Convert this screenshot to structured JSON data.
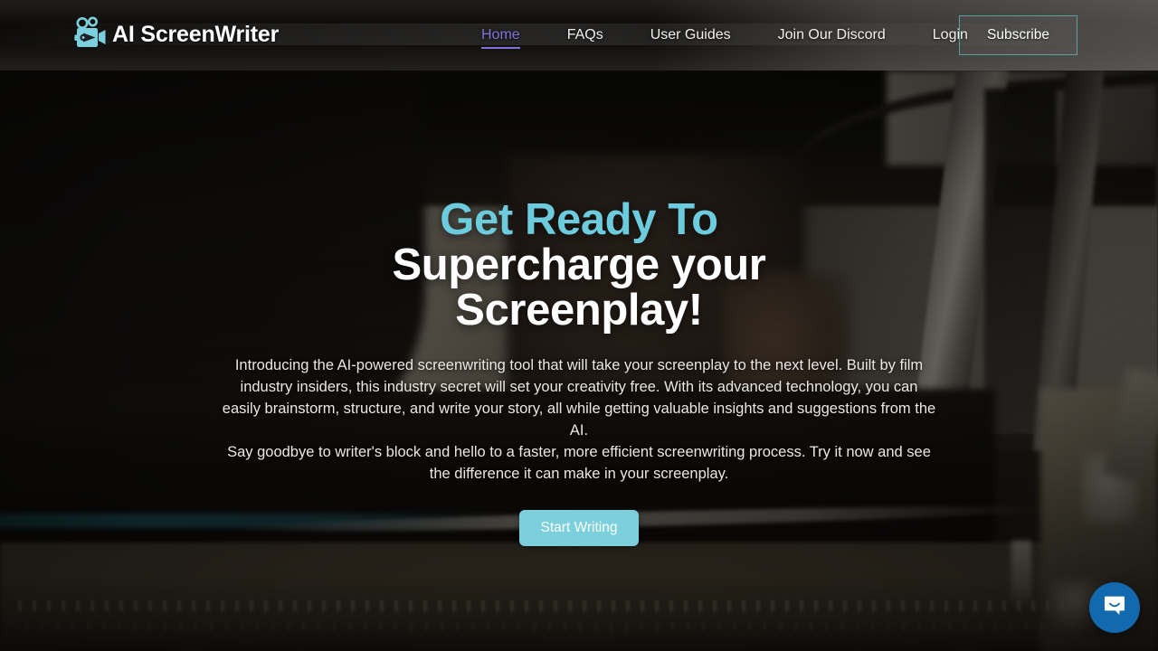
{
  "brand": {
    "name": "AI ScreenWriter",
    "icon": "movie-camera-icon",
    "color": "#7ccfdd"
  },
  "header": {
    "nav": [
      {
        "label": "Home",
        "active": true
      },
      {
        "label": "FAQs",
        "active": false
      },
      {
        "label": "User Guides",
        "active": false
      },
      {
        "label": "Join Our Discord",
        "active": false
      },
      {
        "label": "Login",
        "active": false
      }
    ],
    "subscribe_label": "Subscribe",
    "active_link_color": "#7f72da",
    "subscribe_border_color": "#5f9ba3"
  },
  "hero": {
    "headline_accent": "Get Ready To",
    "headline_line2": "Supercharge your",
    "headline_line3": "Screenplay!",
    "accent_color": "#6ccbdd",
    "paragraph_1": "Introducing the AI-powered screenwriting tool that will take your screenplay to the next level. Built by film industry insiders, this industry secret will set your creativity free. With its advanced technology, you can easily brainstorm, structure, and write your story, all while getting valuable insights and suggestions from the AI.",
    "paragraph_2": "Say goodbye to writer's block and hello to a faster, more efficient screenwriting process. Try it now and see the difference it can make in your screenplay.",
    "cta_label": "Start Writing",
    "cta_color": "#7ccfdd"
  },
  "chat": {
    "icon": "chat-bubble-smile-icon",
    "color": "#1269ad"
  }
}
